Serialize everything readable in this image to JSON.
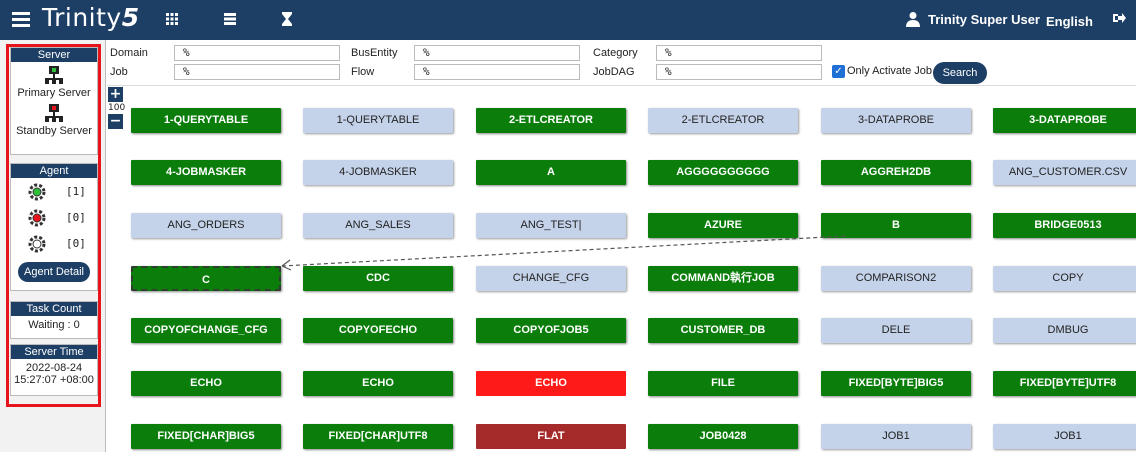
{
  "app": {
    "logo_text": "Trinity",
    "logo_number": "5"
  },
  "topbar": {
    "icons": [
      "menu-icon",
      "grid-icon",
      "list-icon",
      "hourglass-icon"
    ],
    "user_name": "Trinity Super User",
    "language": "English",
    "logout_icon": "logout-icon"
  },
  "sidebar": {
    "server_header": "Server",
    "primary_label": "Primary Server",
    "standby_label": "Standby Server",
    "agent_header": "Agent",
    "agents": [
      {
        "status": "green",
        "count": "[1]"
      },
      {
        "status": "red",
        "count": "[0]"
      },
      {
        "status": "grey",
        "count": "[0]"
      }
    ],
    "agent_detail_label": "Agent Detail",
    "task_header": "Task Count",
    "task_value": "Waiting : 0",
    "time_header": "Server Time",
    "time_date": "2022-08-24",
    "time_clock": "15:27:07 +08:00"
  },
  "filters": {
    "domain_label": "Domain",
    "domain_value": "%",
    "job_label": "Job",
    "job_value": "%",
    "busentity_label": "BusEntity",
    "busentity_value": "%",
    "flow_label": "Flow",
    "flow_value": "%",
    "category_label": "Category",
    "category_value": "%",
    "jobdag_label": "JobDAG",
    "jobdag_value": "%",
    "only_active_label": "Only Activate Job",
    "only_active_checked": true,
    "search_label": "Search"
  },
  "zoom": {
    "plus": "+",
    "value": "100",
    "minus": "−"
  },
  "colors": {
    "green": "#0a7d0a",
    "blue": "#c5d3ea",
    "red": "#ff1a1a",
    "darkred": "#a52a2a",
    "navy": "#1d3f66"
  },
  "jobs": [
    {
      "label": "1-QUERYTABLE",
      "status": "green"
    },
    {
      "label": "1-QUERYTABLE",
      "status": "blue"
    },
    {
      "label": "2-ETLCREATOR",
      "status": "green"
    },
    {
      "label": "2-ETLCREATOR",
      "status": "blue"
    },
    {
      "label": "3-DATAPROBE",
      "status": "blue"
    },
    {
      "label": "3-DATAPROBE",
      "status": "green"
    },
    {
      "label": "4-JOBMASKER",
      "status": "green"
    },
    {
      "label": "4-JOBMASKER",
      "status": "blue"
    },
    {
      "label": "A",
      "status": "green"
    },
    {
      "label": "AGGGGGGGGGG",
      "status": "green"
    },
    {
      "label": "AGGREH2DB",
      "status": "green"
    },
    {
      "label": "ANG_CUSTOMER.CSV",
      "status": "blue"
    },
    {
      "label": "ANG_ORDERS",
      "status": "blue"
    },
    {
      "label": "ANG_SALES",
      "status": "blue"
    },
    {
      "label": "ANG_TEST|",
      "status": "blue"
    },
    {
      "label": "AZURE",
      "status": "green"
    },
    {
      "label": "B",
      "status": "green"
    },
    {
      "label": "BRIDGE0513",
      "status": "green"
    },
    {
      "label": "C",
      "status": "green",
      "selected": true
    },
    {
      "label": "CDC",
      "status": "green"
    },
    {
      "label": "CHANGE_CFG",
      "status": "blue"
    },
    {
      "label": "COMMAND執行JOB",
      "status": "green"
    },
    {
      "label": "COMPARISON2",
      "status": "blue"
    },
    {
      "label": "COPY",
      "status": "blue"
    },
    {
      "label": "COPYOFCHANGE_CFG",
      "status": "green"
    },
    {
      "label": "COPYOFECHO",
      "status": "green"
    },
    {
      "label": "COPYOFJOB5",
      "status": "green"
    },
    {
      "label": "CUSTOMER_DB",
      "status": "green"
    },
    {
      "label": "DELE",
      "status": "blue"
    },
    {
      "label": "DMBUG",
      "status": "blue"
    },
    {
      "label": "ECHO",
      "status": "green"
    },
    {
      "label": "ECHO",
      "status": "green"
    },
    {
      "label": "ECHO",
      "status": "red"
    },
    {
      "label": "FILE",
      "status": "green"
    },
    {
      "label": "FIXED[BYTE]BIG5",
      "status": "green"
    },
    {
      "label": "FIXED[BYTE]UTF8",
      "status": "green"
    },
    {
      "label": "FIXED[CHAR]BIG5",
      "status": "green"
    },
    {
      "label": "FIXED[CHAR]UTF8",
      "status": "green"
    },
    {
      "label": "FLAT",
      "status": "darkred"
    },
    {
      "label": "JOB0428",
      "status": "green"
    },
    {
      "label": "JOB1",
      "status": "blue"
    },
    {
      "label": "JOB1",
      "status": "blue"
    }
  ]
}
